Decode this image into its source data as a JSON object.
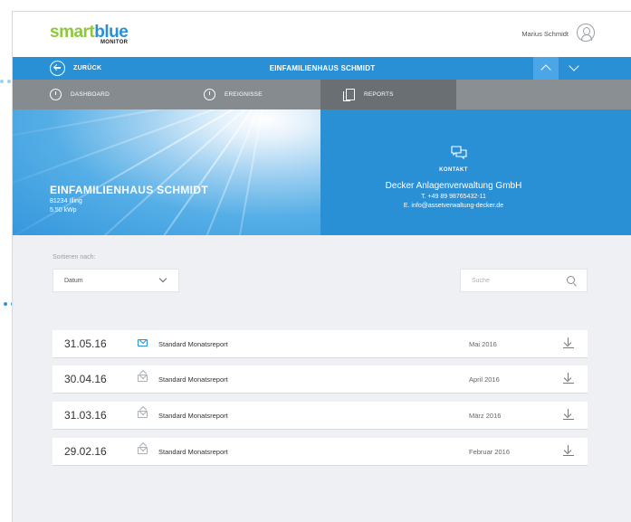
{
  "header": {
    "logo_smart": "smart",
    "logo_blue": "blue",
    "logo_sub": "MONITOR",
    "username": "Marius Schmidt"
  },
  "navbar": {
    "back_label": "ZURÜCK",
    "title": "EINFAMILIENHAUS SCHMIDT"
  },
  "tabs": [
    {
      "label": "DASHBOARD",
      "icon": "gauge-icon"
    },
    {
      "label": "EREIGNISSE",
      "icon": "clock-icon"
    },
    {
      "label": "REPORTS",
      "icon": "document-icon",
      "active": true
    }
  ],
  "hero": {
    "title": "EINFAMILIENHAUS SCHMIDT",
    "location": "81234 Illing",
    "power": "5.50 kWp"
  },
  "contact": {
    "label": "KONTAKT",
    "company": "Decker Anlagenverwaltung GmbH",
    "phone": "T. +49 89 98765432-11",
    "email": "E. info@assetverwaltung-decker.de"
  },
  "controls": {
    "sort_label": "Sortieren nach:",
    "sort_value": "Datum",
    "search_placeholder": "Suche"
  },
  "reports": [
    {
      "date": "31.05.16",
      "name": "Standard Monatsreport",
      "period": "Mai 2016",
      "status": "unread"
    },
    {
      "date": "30.04.16",
      "name": "Standard Monatsreport",
      "period": "April 2016",
      "status": "read"
    },
    {
      "date": "31.03.16",
      "name": "Standard Monatsreport",
      "period": "März 2016",
      "status": "read"
    },
    {
      "date": "29.02.16",
      "name": "Standard Monatsreport",
      "period": "Februar 2016",
      "status": "read"
    }
  ],
  "colors": {
    "brand_blue": "#2a90d6",
    "brand_green": "#8dc63f",
    "tab_gray": "#868b8f",
    "tab_active": "#6a6f73"
  }
}
